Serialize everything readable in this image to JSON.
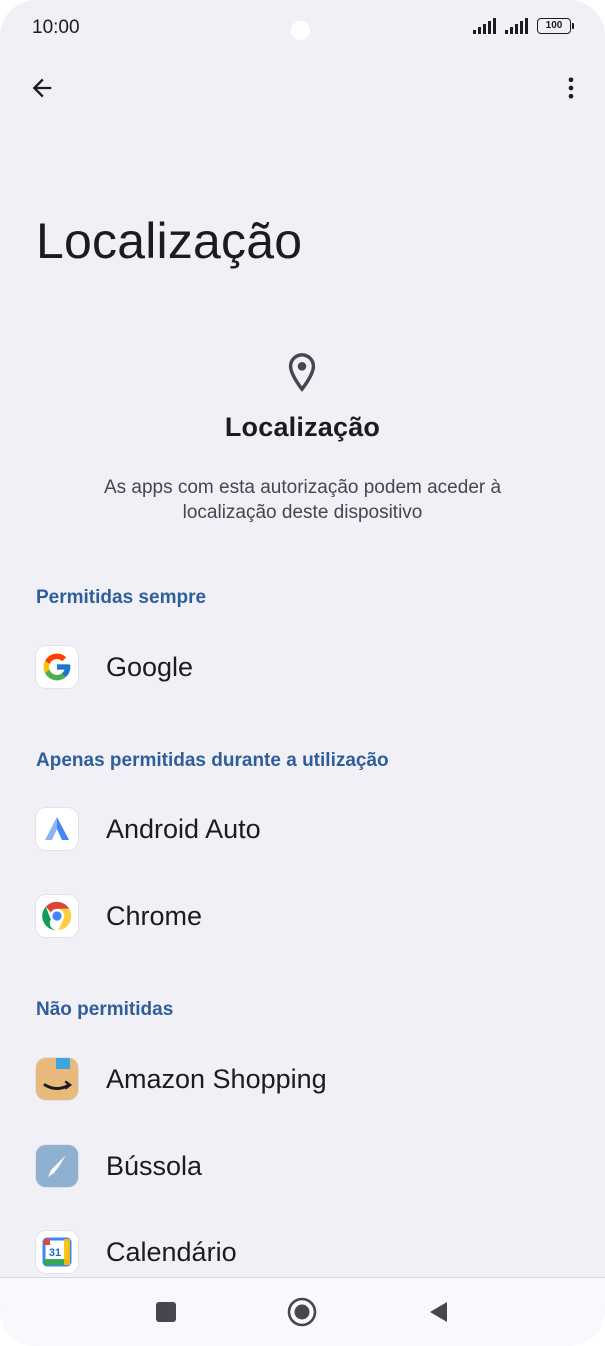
{
  "status_bar": {
    "time": "10:00",
    "battery": "100"
  },
  "toolbar": {
    "back_icon": "arrow-back-icon",
    "more_icon": "more-vert-icon"
  },
  "page": {
    "title": "Localização",
    "header_icon": "location-pin-icon",
    "heading": "Localização",
    "description": "As apps com esta autorização podem aceder à localização deste dispositivo"
  },
  "groups": {
    "always": {
      "label": "Permitidas sempre",
      "apps": [
        {
          "name": "Google",
          "icon": "google-icon"
        }
      ]
    },
    "while_using": {
      "label": "Apenas permitidas durante a utilização",
      "apps": [
        {
          "name": "Android Auto",
          "icon": "android-auto-icon"
        },
        {
          "name": "Chrome",
          "icon": "chrome-icon"
        }
      ]
    },
    "denied": {
      "label": "Não permitidas",
      "apps": [
        {
          "name": "Amazon Shopping",
          "icon": "amazon-shopping-icon"
        },
        {
          "name": "Bússola",
          "icon": "compass-icon"
        },
        {
          "name": "Calendário",
          "icon": "calendar-icon",
          "badge": "31"
        }
      ]
    }
  },
  "nav_bar": {
    "recents_icon": "recents-square-icon",
    "home_icon": "home-circle-icon",
    "back_icon": "back-triangle-icon"
  },
  "colors": {
    "background": "#f1f0f6",
    "section_label": "#2e5f9b",
    "text_primary": "#1c1b1f"
  }
}
